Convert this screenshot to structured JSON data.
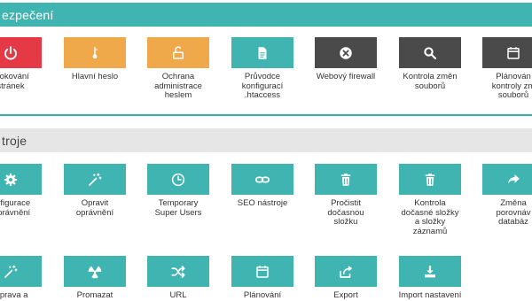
{
  "colors": {
    "teal": "#3fb4b0",
    "red": "#e53945",
    "orange": "#f0a94a",
    "dark": "#4a4a4a",
    "header_gray": "#e6e6e6"
  },
  "security": {
    "title": "ezpečení",
    "items": [
      {
        "label": "Blokování\nstránek",
        "icon": "power-icon",
        "color": "#e53945"
      },
      {
        "label": "Hlavní heslo",
        "icon": "key-icon",
        "color": "#f0a94a"
      },
      {
        "label": "Ochrana\nadministrace\nheslem",
        "icon": "unlock-icon",
        "color": "#f0a94a"
      },
      {
        "label": "Průvodce\nkonfigurací\n.htaccess",
        "icon": "document-icon",
        "color": "#3fb4b0"
      },
      {
        "label": "Webový firewall",
        "icon": "close-circle-icon",
        "color": "#4a4a4a"
      },
      {
        "label": "Kontrola změn\nsouborů",
        "icon": "search-icon",
        "color": "#4a4a4a"
      },
      {
        "label": "Plánován\nkontroly zm\nsouborů",
        "icon": "calendar-icon",
        "color": "#4a4a4a"
      }
    ]
  },
  "tools": {
    "title": "troje",
    "items": [
      {
        "label": "onfigurace\nOprávnění",
        "icon": "gear-icon",
        "color": "#3fb4b0"
      },
      {
        "label": "Opravit\noprávnění",
        "icon": "magic-wand-icon",
        "color": "#3fb4b0"
      },
      {
        "label": "Temporary\nSuper Users",
        "icon": "clock-icon",
        "color": "#3fb4b0"
      },
      {
        "label": "SEO nástroje",
        "icon": "link-icon",
        "color": "#3fb4b0"
      },
      {
        "label": "Pročistit\ndočasnou\nsložku",
        "icon": "trash-icon",
        "color": "#3fb4b0"
      },
      {
        "label": "Kontrola\ndočasné složky\na složky\nzáznamů",
        "icon": "trash-icon",
        "color": "#3fb4b0"
      },
      {
        "label": "Změna\nporovnáv\ndatabáz",
        "icon": "share-icon",
        "color": "#3fb4b0"
      },
      {
        "label": "Oprava a",
        "icon": "magic-wand-icon",
        "color": "#3fb4b0"
      },
      {
        "label": "Promazat",
        "icon": "radiation-icon",
        "color": "#3fb4b0"
      },
      {
        "label": "URL",
        "icon": "shuffle-icon",
        "color": "#3fb4b0"
      },
      {
        "label": "Plánování",
        "icon": "calendar-icon",
        "color": "#3fb4b0"
      },
      {
        "label": "Export",
        "icon": "export-icon",
        "color": "#3fb4b0"
      },
      {
        "label": "Import nastavení",
        "icon": "import-icon",
        "color": "#3fb4b0"
      }
    ]
  }
}
